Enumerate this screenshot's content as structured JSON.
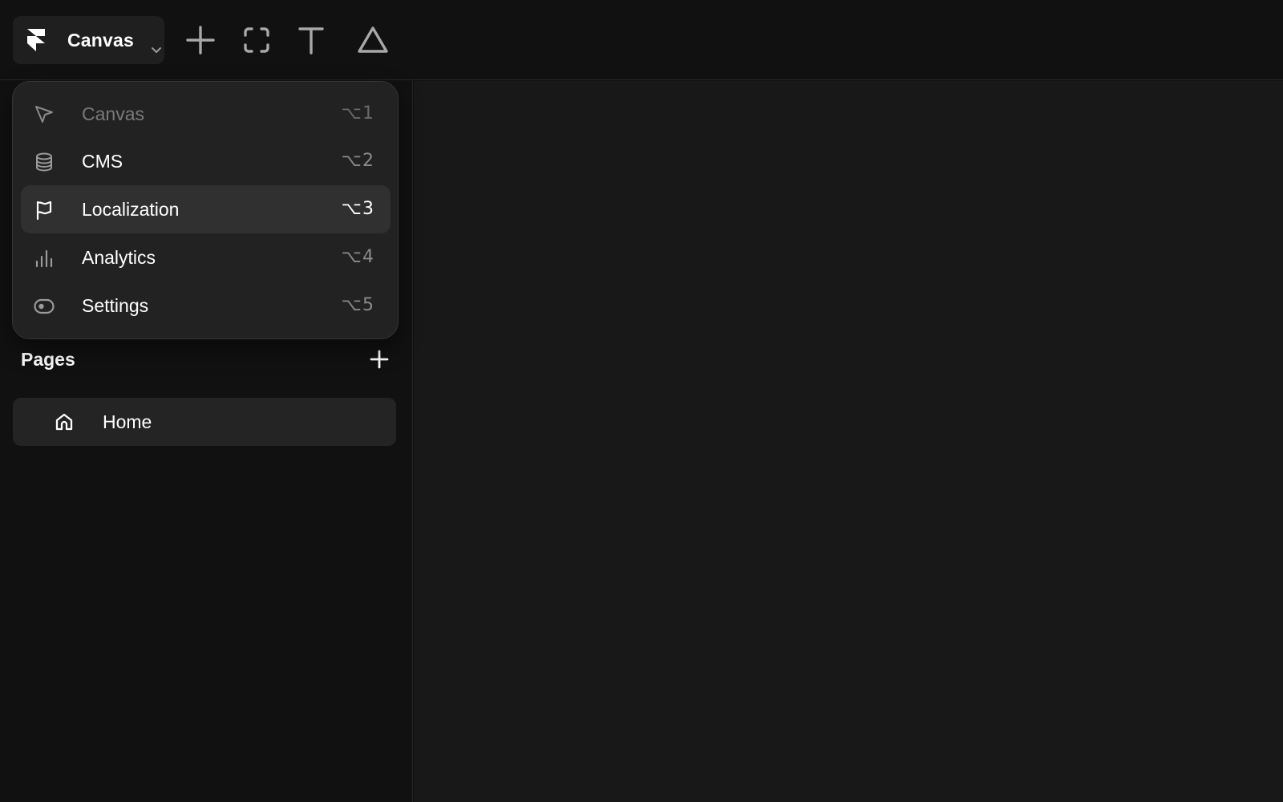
{
  "toolbar": {
    "mode_label": "Canvas",
    "tools": [
      {
        "name": "plus-icon"
      },
      {
        "name": "frame-icon"
      },
      {
        "name": "text-icon"
      },
      {
        "name": "triangle-icon"
      }
    ]
  },
  "mode_menu": {
    "items": [
      {
        "label": "Canvas",
        "shortcut": "⌥1",
        "icon": "cursor-icon",
        "state": "disabled"
      },
      {
        "label": "CMS",
        "shortcut": "⌥2",
        "icon": "database-icon",
        "state": "normal"
      },
      {
        "label": "Localization",
        "shortcut": "⌥3",
        "icon": "flag-icon",
        "state": "hovered"
      },
      {
        "label": "Analytics",
        "shortcut": "⌥4",
        "icon": "bar-chart-icon",
        "state": "normal"
      },
      {
        "label": "Settings",
        "shortcut": "⌥5",
        "icon": "toggle-icon",
        "state": "normal"
      }
    ]
  },
  "pages": {
    "title": "Pages",
    "items": [
      {
        "label": "Home",
        "icon": "home-icon"
      }
    ]
  },
  "colors": {
    "background": "#111111",
    "canvas": "#181818",
    "menu_bg": "#222222",
    "menu_hover": "#303030",
    "text": "#ffffff",
    "muted": "#8a8a8a"
  }
}
